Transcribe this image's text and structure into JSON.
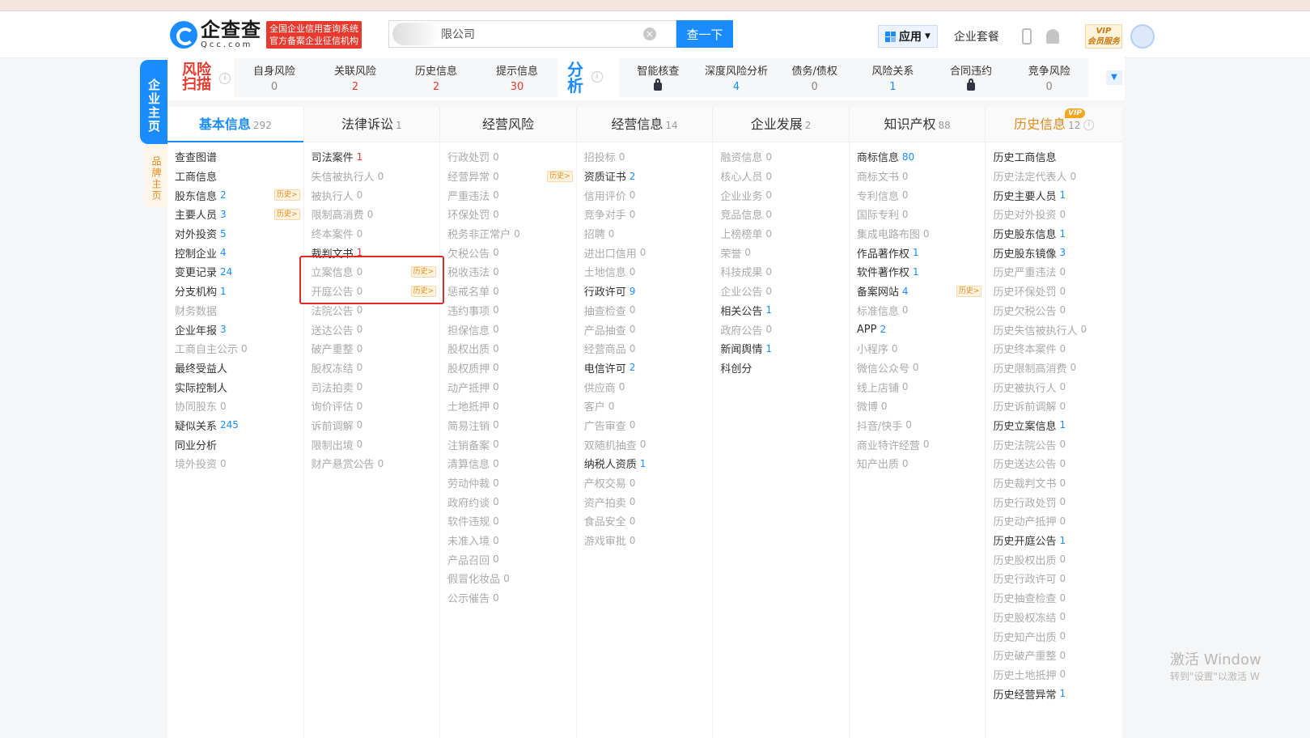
{
  "header": {
    "logo_cn": "企查查",
    "logo_en": "Qcc.com",
    "slogan_line1": "全国企业信用查询系统",
    "slogan_line2": "官方备案企业征信机构",
    "search_value": "限公司",
    "search_button": "查一下",
    "app_button": "应用",
    "package_link": "企业套餐",
    "vip_line1": "VIP",
    "vip_line2": "会员服务"
  },
  "sidetabs": {
    "main": "企业主页",
    "brand": "品牌主页"
  },
  "risk_scan": {
    "title": "风险扫描",
    "items": [
      {
        "label": "自身风险",
        "value": "0"
      },
      {
        "label": "关联风险",
        "value": "2"
      },
      {
        "label": "历史信息",
        "value": "2"
      },
      {
        "label": "提示信息",
        "value": "30"
      }
    ]
  },
  "analysis": {
    "title": "分析",
    "items": [
      {
        "label": "智能核查",
        "value": ""
      },
      {
        "label": "深度风险分析",
        "value": "4"
      },
      {
        "label": "债务/债权",
        "value": "0"
      },
      {
        "label": "风险关系",
        "value": "1"
      },
      {
        "label": "合同违约",
        "value": ""
      },
      {
        "label": "竞争风险",
        "value": "0"
      }
    ]
  },
  "columns": [
    {
      "title": "基本信息",
      "count": "292",
      "items": [
        {
          "label": "查查图谱",
          "n": ""
        },
        {
          "label": "工商信息",
          "n": ""
        },
        {
          "label": "股东信息",
          "n": "2",
          "hist": true
        },
        {
          "label": "主要人员",
          "n": "3",
          "hist": true
        },
        {
          "label": "对外投资",
          "n": "5"
        },
        {
          "label": "控制企业",
          "n": "4"
        },
        {
          "label": "变更记录",
          "n": "24"
        },
        {
          "label": "分支机构",
          "n": "1"
        },
        {
          "label": "财务数据",
          "n": "",
          "dim": true
        },
        {
          "label": "企业年报",
          "n": "3"
        },
        {
          "label": "工商自主公示",
          "n": "0",
          "dim": true
        },
        {
          "label": "最终受益人",
          "n": ""
        },
        {
          "label": "实际控制人",
          "n": ""
        },
        {
          "label": "协同股东",
          "n": "0",
          "dim": true
        },
        {
          "label": "疑似关系",
          "n": "245"
        },
        {
          "label": "同业分析",
          "n": ""
        },
        {
          "label": "境外投资",
          "n": "0",
          "dim": true
        }
      ]
    },
    {
      "title": "法律诉讼",
      "count": "1",
      "items": [
        {
          "label": "司法案件",
          "n": "1",
          "red": true
        },
        {
          "label": "失信被执行人",
          "n": "0",
          "dim": true
        },
        {
          "label": "被执行人",
          "n": "0",
          "dim": true
        },
        {
          "label": "限制高消费",
          "n": "0",
          "dim": true
        },
        {
          "label": "终本案件",
          "n": "0",
          "dim": true
        },
        {
          "label": "裁判文书",
          "n": "1",
          "red": true
        },
        {
          "label": "立案信息",
          "n": "0",
          "dim": true,
          "hist": true
        },
        {
          "label": "开庭公告",
          "n": "0",
          "dim": true,
          "hist": true
        },
        {
          "label": "法院公告",
          "n": "0",
          "dim": true
        },
        {
          "label": "送达公告",
          "n": "0",
          "dim": true
        },
        {
          "label": "破产重整",
          "n": "0",
          "dim": true
        },
        {
          "label": "股权冻结",
          "n": "0",
          "dim": true
        },
        {
          "label": "司法拍卖",
          "n": "0",
          "dim": true
        },
        {
          "label": "询价评估",
          "n": "0",
          "dim": true
        },
        {
          "label": "诉前调解",
          "n": "0",
          "dim": true
        },
        {
          "label": "限制出境",
          "n": "0",
          "dim": true
        },
        {
          "label": "财产悬赏公告",
          "n": "0",
          "dim": true
        }
      ]
    },
    {
      "title": "经营风险",
      "count": "",
      "items": [
        {
          "label": "行政处罚",
          "n": "0",
          "dim": true
        },
        {
          "label": "经营异常",
          "n": "0",
          "dim": true,
          "hist": true
        },
        {
          "label": "严重违法",
          "n": "0",
          "dim": true
        },
        {
          "label": "环保处罚",
          "n": "0",
          "dim": true
        },
        {
          "label": "税务非正常户",
          "n": "0",
          "dim": true
        },
        {
          "label": "欠税公告",
          "n": "0",
          "dim": true
        },
        {
          "label": "税收违法",
          "n": "0",
          "dim": true
        },
        {
          "label": "惩戒名单",
          "n": "0",
          "dim": true
        },
        {
          "label": "违约事项",
          "n": "0",
          "dim": true
        },
        {
          "label": "担保信息",
          "n": "0",
          "dim": true
        },
        {
          "label": "股权出质",
          "n": "0",
          "dim": true
        },
        {
          "label": "股权质押",
          "n": "0",
          "dim": true
        },
        {
          "label": "动产抵押",
          "n": "0",
          "dim": true
        },
        {
          "label": "土地抵押",
          "n": "0",
          "dim": true
        },
        {
          "label": "简易注销",
          "n": "0",
          "dim": true
        },
        {
          "label": "注销备案",
          "n": "0",
          "dim": true
        },
        {
          "label": "清算信息",
          "n": "0",
          "dim": true
        },
        {
          "label": "劳动仲裁",
          "n": "0",
          "dim": true
        },
        {
          "label": "政府约谈",
          "n": "0",
          "dim": true
        },
        {
          "label": "软件违规",
          "n": "0",
          "dim": true
        },
        {
          "label": "未准入境",
          "n": "0",
          "dim": true
        },
        {
          "label": "产品召回",
          "n": "0",
          "dim": true
        },
        {
          "label": "假冒化妆品",
          "n": "0",
          "dim": true
        },
        {
          "label": "公示催告",
          "n": "0",
          "dim": true
        }
      ]
    },
    {
      "title": "经营信息",
      "count": "14",
      "items": [
        {
          "label": "招投标",
          "n": "0",
          "dim": true
        },
        {
          "label": "资质证书",
          "n": "2"
        },
        {
          "label": "信用评价",
          "n": "0",
          "dim": true
        },
        {
          "label": "竞争对手",
          "n": "0",
          "dim": true
        },
        {
          "label": "招聘",
          "n": "0",
          "dim": true
        },
        {
          "label": "进出口信用",
          "n": "0",
          "dim": true
        },
        {
          "label": "土地信息",
          "n": "0",
          "dim": true
        },
        {
          "label": "行政许可",
          "n": "9"
        },
        {
          "label": "抽查检查",
          "n": "0",
          "dim": true
        },
        {
          "label": "产品抽查",
          "n": "0",
          "dim": true
        },
        {
          "label": "经营商品",
          "n": "0",
          "dim": true
        },
        {
          "label": "电信许可",
          "n": "2"
        },
        {
          "label": "供应商",
          "n": "0",
          "dim": true
        },
        {
          "label": "客户",
          "n": "0",
          "dim": true
        },
        {
          "label": "广告审查",
          "n": "0",
          "dim": true
        },
        {
          "label": "双随机抽查",
          "n": "0",
          "dim": true
        },
        {
          "label": "纳税人资质",
          "n": "1"
        },
        {
          "label": "产权交易",
          "n": "0",
          "dim": true
        },
        {
          "label": "资产拍卖",
          "n": "0",
          "dim": true
        },
        {
          "label": "食品安全",
          "n": "0",
          "dim": true
        },
        {
          "label": "游戏审批",
          "n": "0",
          "dim": true
        }
      ]
    },
    {
      "title": "企业发展",
      "count": "2",
      "items": [
        {
          "label": "融资信息",
          "n": "0",
          "dim": true
        },
        {
          "label": "核心人员",
          "n": "0",
          "dim": true
        },
        {
          "label": "企业业务",
          "n": "0",
          "dim": true
        },
        {
          "label": "竞品信息",
          "n": "0",
          "dim": true
        },
        {
          "label": "上榜榜单",
          "n": "0",
          "dim": true
        },
        {
          "label": "荣誉",
          "n": "0",
          "dim": true
        },
        {
          "label": "科技成果",
          "n": "0",
          "dim": true
        },
        {
          "label": "企业公告",
          "n": "0",
          "dim": true
        },
        {
          "label": "相关公告",
          "n": "1"
        },
        {
          "label": "政府公告",
          "n": "0",
          "dim": true
        },
        {
          "label": "新闻舆情",
          "n": "1"
        },
        {
          "label": "科创分",
          "n": ""
        }
      ]
    },
    {
      "title": "知识产权",
      "count": "88",
      "items": [
        {
          "label": "商标信息",
          "n": "80"
        },
        {
          "label": "商标文书",
          "n": "0",
          "dim": true
        },
        {
          "label": "专利信息",
          "n": "0",
          "dim": true
        },
        {
          "label": "国际专利",
          "n": "0",
          "dim": true
        },
        {
          "label": "集成电路布图",
          "n": "0",
          "dim": true
        },
        {
          "label": "作品著作权",
          "n": "1"
        },
        {
          "label": "软件著作权",
          "n": "1"
        },
        {
          "label": "备案网站",
          "n": "4",
          "hist": true
        },
        {
          "label": "标准信息",
          "n": "0",
          "dim": true
        },
        {
          "label": "APP",
          "n": "2"
        },
        {
          "label": "小程序",
          "n": "0",
          "dim": true
        },
        {
          "label": "微信公众号",
          "n": "0",
          "dim": true
        },
        {
          "label": "线上店铺",
          "n": "0",
          "dim": true
        },
        {
          "label": "微博",
          "n": "0",
          "dim": true
        },
        {
          "label": "抖音/快手",
          "n": "0",
          "dim": true
        },
        {
          "label": "商业特许经营",
          "n": "0",
          "dim": true
        },
        {
          "label": "知产出质",
          "n": "0",
          "dim": true
        }
      ]
    },
    {
      "title": "历史信息",
      "count": "12",
      "vip": "VIP",
      "items": [
        {
          "label": "历史工商信息",
          "n": ""
        },
        {
          "label": "历史法定代表人",
          "n": "0",
          "dim": true
        },
        {
          "label": "历史主要人员",
          "n": "1"
        },
        {
          "label": "历史对外投资",
          "n": "0",
          "dim": true
        },
        {
          "label": "历史股东信息",
          "n": "1"
        },
        {
          "label": "历史股东镜像",
          "n": "3"
        },
        {
          "label": "历史严重违法",
          "n": "0",
          "dim": true
        },
        {
          "label": "历史环保处罚",
          "n": "0",
          "dim": true
        },
        {
          "label": "历史欠税公告",
          "n": "0",
          "dim": true
        },
        {
          "label": "历史失信被执行人",
          "n": "0",
          "dim": true
        },
        {
          "label": "历史终本案件",
          "n": "0",
          "dim": true
        },
        {
          "label": "历史限制高消费",
          "n": "0",
          "dim": true
        },
        {
          "label": "历史被执行人",
          "n": "0",
          "dim": true
        },
        {
          "label": "历史诉前调解",
          "n": "0",
          "dim": true
        },
        {
          "label": "历史立案信息",
          "n": "1"
        },
        {
          "label": "历史法院公告",
          "n": "0",
          "dim": true
        },
        {
          "label": "历史送达公告",
          "n": "0",
          "dim": true
        },
        {
          "label": "历史裁判文书",
          "n": "0",
          "dim": true
        },
        {
          "label": "历史行政处罚",
          "n": "0",
          "dim": true
        },
        {
          "label": "历史动产抵押",
          "n": "0",
          "dim": true
        },
        {
          "label": "历史开庭公告",
          "n": "1"
        },
        {
          "label": "历史股权出质",
          "n": "0",
          "dim": true
        },
        {
          "label": "历史行政许可",
          "n": "0",
          "dim": true
        },
        {
          "label": "历史抽查检查",
          "n": "0",
          "dim": true
        },
        {
          "label": "历史股权冻结",
          "n": "0",
          "dim": true
        },
        {
          "label": "历史知产出质",
          "n": "0",
          "dim": true
        },
        {
          "label": "历史破产重整",
          "n": "0",
          "dim": true
        },
        {
          "label": "历史土地抵押",
          "n": "0",
          "dim": true
        },
        {
          "label": "历史经营异常",
          "n": "1"
        }
      ]
    }
  ],
  "history_tag": "历史>",
  "watermark": {
    "line1": "激活 Window",
    "line2": "转到\"设置\"以激活 W"
  }
}
